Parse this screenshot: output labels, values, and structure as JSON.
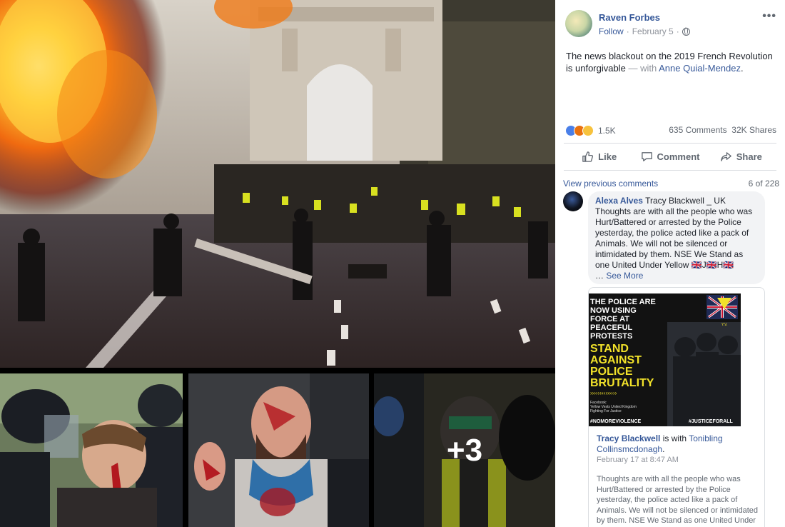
{
  "post": {
    "author": "Raven Forbes",
    "follow": "Follow",
    "separator": "·",
    "date": "February 5",
    "dot": "·",
    "more_icon": "•••",
    "text": "The news blackout on the 2019 French Revolution is unforgivable",
    "with_text": "— with",
    "tagged": "Anne Quial-Mendez",
    "tagged_suffix": "."
  },
  "stats": {
    "reactions": "1.5K",
    "comments": "635 Comments",
    "shares": "32K Shares"
  },
  "actions": {
    "like": "Like",
    "comment": "Comment",
    "share": "Share"
  },
  "photos": {
    "more_overlay": "+3"
  },
  "comments": {
    "view_previous": "View previous comments",
    "count": "6 of 228",
    "first": {
      "author": "Alexa Alves",
      "text": "Tracy Blackwell _ UK Thoughts are with all the people who was Hurt/Battered or arrested by the Police yesterday, the police acted like a pack of Animals. We will not be silenced or intimidated by them. NSE We Stand as one United Under Yellow 🇬🇧J🇬🇧H🇬🇧",
      "ellipsis": "…",
      "see_more": "See More"
    },
    "shared": {
      "image_lines": [
        "THE POLICE ARE",
        "NOW USING",
        "FORCE AT",
        "PEACEFUL",
        "PROTESTS"
      ],
      "image_headline": [
        "STAND",
        "AGAINST",
        "POLICE",
        "BRUTALITY"
      ],
      "image_small": [
        "Facebook:",
        "Yellow Vests United Kingdom",
        "Fighting For Justice"
      ],
      "hashtag_left": "#NOMOREVIOLENCE",
      "hashtag_right": "#JUSTICEFORALL",
      "badge": "Y.V.",
      "author": "Tracy Blackwell",
      "is_with": "is with",
      "tagged": "Tonibling Collinsmcdonagh",
      "tagged_suffix": ".",
      "date": "February 17 at 8:47 AM",
      "body": "Thoughts are with all the people who was Hurt/Battered or arrested by the Police yesterday, the police acted like a pack of Animals. We will not be silenced or intimidated by them. NSE We Stand as one United Under"
    }
  },
  "colors": {
    "link": "#365899",
    "meta": "#90949c",
    "text": "#1d2129",
    "bubble": "#f2f3f5",
    "like_blue": "#4a7fe8",
    "angry_orange": "#e9710f",
    "wow_yellow": "#f7c23d"
  },
  "icons": {
    "globe": "globe-icon",
    "more": "more-options-icon",
    "like": "thumbs-up-icon",
    "comment": "speech-bubble-icon",
    "share": "share-arrow-icon"
  }
}
